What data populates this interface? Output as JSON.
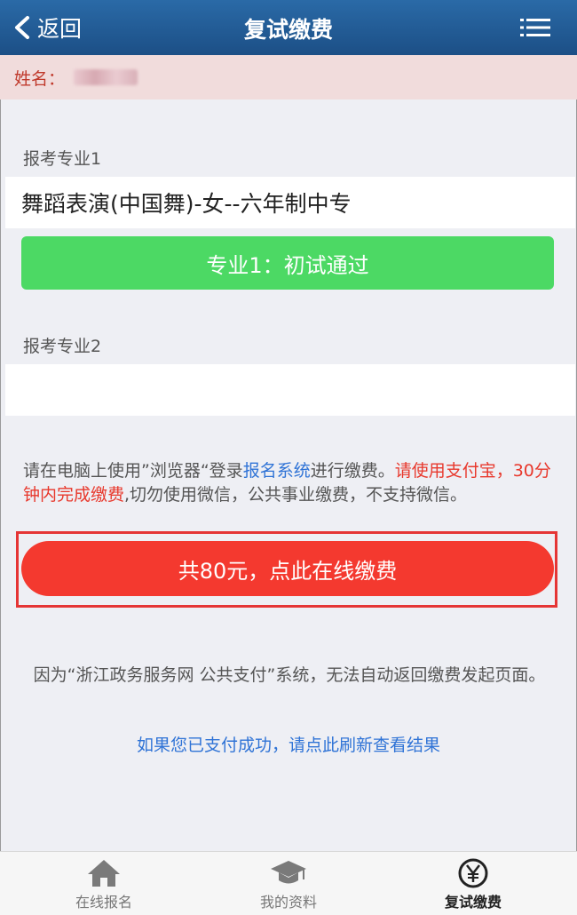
{
  "header": {
    "back_label": "返回",
    "title": "复试缴费"
  },
  "user": {
    "name_label": "姓名："
  },
  "major1": {
    "label": "报考专业1",
    "value": "舞蹈表演(中国舞)-女--六年制中专",
    "status": "专业1：初试通过"
  },
  "major2": {
    "label": "报考专业2",
    "value": ""
  },
  "notice": {
    "p1": "请在电脑上使用”浏览器“登录",
    "link": "报名系统",
    "p2": "进行缴费。",
    "red": "请使用支付宝，30分钟内完成缴费",
    "p3": ",切勿使用微信，公共事业缴费，不支持微信。"
  },
  "pay_button": "共80元，点此在线缴费",
  "info_text": "因为“浙江政务服务网 公共支付”系统，无法自动返回缴费发起页面。",
  "refresh_link": "如果您已支付成功，请点此刷新查看结果",
  "tabs": [
    {
      "label": "在线报名",
      "icon": "home-icon",
      "active": false
    },
    {
      "label": "我的资料",
      "icon": "graduation-cap-icon",
      "active": false
    },
    {
      "label": "复试缴费",
      "icon": "yen-icon",
      "active": true
    }
  ],
  "colors": {
    "header": "#1c4f86",
    "success": "#4cd964",
    "danger": "#f4392f",
    "link": "#2f73d6"
  }
}
